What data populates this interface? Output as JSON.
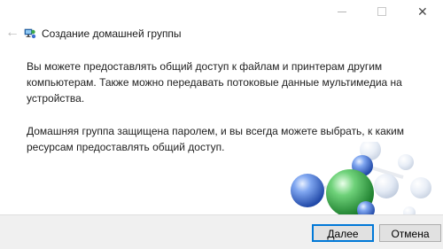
{
  "window": {
    "title": "Создание домашней группы",
    "controls": {
      "minimize_icon": "minimize-icon",
      "maximize_icon": "maximize-icon",
      "close_icon": "close-icon",
      "close_glyph": "✕"
    },
    "back_glyph": "←"
  },
  "content": {
    "paragraph1": "Вы можете предоставлять общий доступ к файлам и принтерам другим компьютерам. Также можно передавать потоковые данные мультимедиа на устройства.",
    "paragraph2": "Домашняя группа защищена паролем, и вы всегда можете выбрать, к каким ресурсам предоставлять общий доступ."
  },
  "buttons": {
    "next": "Далее",
    "cancel": "Отмена"
  },
  "colors": {
    "accent": "#0078d7",
    "footer_bg": "#f0f0f0",
    "ball_blue": "#3d6fd0",
    "ball_green": "#36b24a"
  }
}
